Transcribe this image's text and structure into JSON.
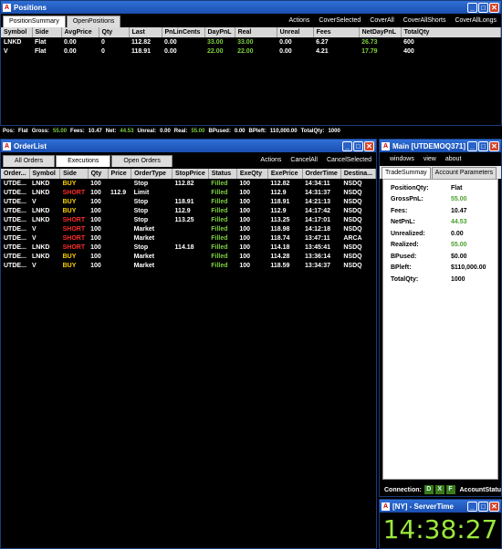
{
  "positions": {
    "title": "Positions",
    "tabs": [
      "PositionSummary",
      "OpenPositions"
    ],
    "actions": [
      "Actions",
      "CoverSelected",
      "CoverAll",
      "CoverAllShorts",
      "CoverAllLongs"
    ],
    "columns": [
      "Symbol",
      "Side",
      "AvgPrice",
      "Qty",
      "Last",
      "PnLinCents",
      "DayPnL",
      "Real",
      "Unreal",
      "Fees",
      "NetDayPnL",
      "TotalQty"
    ],
    "rows": [
      [
        "LNKD",
        "Flat",
        "0.00",
        "0",
        "112.82",
        "0.00",
        "33.00",
        "33.00",
        "0.00",
        "6.27",
        "26.73",
        "600"
      ],
      [
        "V",
        "Flat",
        "0.00",
        "0",
        "118.91",
        "0.00",
        "22.00",
        "22.00",
        "0.00",
        "4.21",
        "17.79",
        "400"
      ]
    ]
  },
  "status_line": {
    "pos_label": "Pos:",
    "pos_value": "Flat",
    "gross_label": "Gross:",
    "gross_value": "55.00",
    "fees_label": "Fees:",
    "fees_value": "10.47",
    "net_label": "Net:",
    "net_value": "44.53",
    "unreal_label": "Unreal:",
    "unreal_value": "0.00",
    "real_label": "Real:",
    "real_value": "55.00",
    "bpused_label": "BPused:",
    "bpused_value": "0.00",
    "bpleft_label": "BPleft:",
    "bpleft_value": "110,000.00",
    "totalqty_label": "TotalQty:",
    "totalqty_value": "1000"
  },
  "orderlist": {
    "title": "OrderList",
    "tabs": [
      "All Orders",
      "Executions",
      "Open Orders"
    ],
    "actions": [
      "Actions",
      "CancelAll",
      "CancelSelected"
    ],
    "columns": [
      "Order...",
      "Symbol",
      "Side",
      "Qty",
      "Price",
      "OrderType",
      "StopPrice",
      "Status",
      "ExeQty",
      "ExePrice",
      "OrderTime",
      "Destina..."
    ],
    "rows": [
      [
        "UTDE...",
        "LNKD",
        "BUY",
        "100",
        "",
        "Stop",
        "112.82",
        "Filled",
        "100",
        "112.82",
        "14:34:11",
        "NSDQ"
      ],
      [
        "UTDE...",
        "LNKD",
        "SHORT",
        "100",
        "112.9",
        "Limit",
        "",
        "Filled",
        "100",
        "112.9",
        "14:31:37",
        "NSDQ"
      ],
      [
        "UTDE...",
        "V",
        "BUY",
        "100",
        "",
        "Stop",
        "118.91",
        "Filled",
        "100",
        "118.91",
        "14:21:13",
        "NSDQ"
      ],
      [
        "UTDE...",
        "LNKD",
        "BUY",
        "100",
        "",
        "Stop",
        "112.9",
        "Filled",
        "100",
        "112.9",
        "14:17:42",
        "NSDQ"
      ],
      [
        "UTDE...",
        "LNKD",
        "SHORT",
        "100",
        "",
        "Stop",
        "113.25",
        "Filled",
        "100",
        "113.25",
        "14:17:01",
        "NSDQ"
      ],
      [
        "UTDE...",
        "V",
        "SHORT",
        "100",
        "",
        "Market",
        "",
        "Filled",
        "100",
        "118.98",
        "14:12:18",
        "NSDQ"
      ],
      [
        "UTDE...",
        "V",
        "SHORT",
        "100",
        "",
        "Market",
        "",
        "Filled",
        "100",
        "118.74",
        "13:47:11",
        "ARCA"
      ],
      [
        "UTDE...",
        "LNKD",
        "SHORT",
        "100",
        "",
        "Stop",
        "114.18",
        "Filled",
        "100",
        "114.18",
        "13:45:41",
        "NSDQ"
      ],
      [
        "UTDE...",
        "LNKD",
        "BUY",
        "100",
        "",
        "Market",
        "",
        "Filled",
        "100",
        "114.28",
        "13:36:14",
        "NSDQ"
      ],
      [
        "UTDE...",
        "V",
        "BUY",
        "100",
        "",
        "Market",
        "",
        "Filled",
        "100",
        "118.59",
        "13:34:37",
        "NSDQ"
      ]
    ]
  },
  "main": {
    "title": "Main [UTDEMOQ371]",
    "menu": [
      "windows",
      "view",
      "about"
    ],
    "tabs": [
      "TradeSummay",
      "Account Parameters"
    ],
    "summary": [
      [
        "PositionQty:",
        "Flat"
      ],
      [
        "GrossPnL:",
        "55.00"
      ],
      [
        "Fees:",
        "10.47"
      ],
      [
        "NetPnL:",
        "44.53"
      ],
      [
        "Unrealized:",
        "0.00"
      ],
      [
        "Realized:",
        "55.00"
      ],
      [
        "BPused:",
        "$0.00"
      ],
      [
        "BPleft:",
        "$110,000.00"
      ],
      [
        "TotalQty:",
        "1000"
      ]
    ],
    "connection_label": "Connection:",
    "connection_boxes": [
      "D",
      "X",
      "F"
    ],
    "account_status": "AccountStatu"
  },
  "servertime": {
    "title": "[NY] - ServerTime",
    "time": "14:38:27"
  },
  "colors": {
    "buy": "#7ccf3e",
    "short": "#ff2b2b",
    "filled": "#7ccf3e",
    "clock": "#9be83c"
  }
}
